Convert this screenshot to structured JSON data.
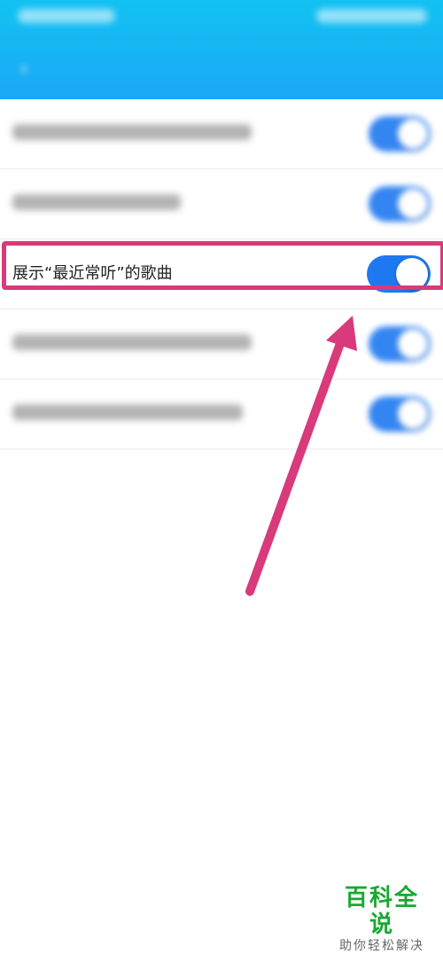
{
  "header": {
    "title": "",
    "back_icon": "chevron-left-icon",
    "colors": {
      "gradient_top": "#12c2f2",
      "gradient_bottom": "#1aa8f5"
    }
  },
  "settings": {
    "rows": [
      {
        "label": "",
        "enabled": true,
        "blurred": true
      },
      {
        "label": "",
        "enabled": true,
        "blurred": true
      },
      {
        "label": "展示“最近常听”的歌曲",
        "enabled": true,
        "blurred": false
      },
      {
        "label": "",
        "enabled": true,
        "blurred": true
      },
      {
        "label": "",
        "enabled": true,
        "blurred": true
      }
    ]
  },
  "annotation": {
    "color": "#d93a7b"
  },
  "toggle_color": "#1e78f0",
  "watermark": {
    "title": "百科全说",
    "subtitle": "助你轻松解决"
  }
}
